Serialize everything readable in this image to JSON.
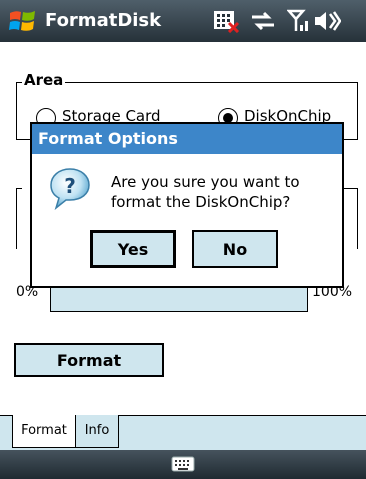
{
  "titlebar": {
    "title": "FormatDisk",
    "icons": [
      "windows-start-icon",
      "sim-card-missing-icon",
      "data-connection-icon",
      "signal-icon",
      "volume-icon"
    ]
  },
  "area": {
    "legend": "Area",
    "options": [
      {
        "label": "Storage Card",
        "checked": false
      },
      {
        "label": "DiskOnChip",
        "checked": true
      }
    ]
  },
  "progress": {
    "min_label": "0%",
    "max_label": "100%",
    "value_percent": 0
  },
  "format_button": {
    "label": "Format"
  },
  "dialog": {
    "title": "Format Options",
    "message": "Are you sure you want to format the DiskOnChip?",
    "yes_label": "Yes",
    "no_label": "No",
    "icon": "question-icon"
  },
  "tabs": [
    {
      "label": "Format",
      "active": true
    },
    {
      "label": "Info",
      "active": false
    }
  ],
  "bottombar": {
    "icon": "keyboard-icon"
  },
  "colors": {
    "title_gradient": "#263139",
    "dialog_title": "#3d86c9",
    "button_fill": "#cfe6ee"
  }
}
